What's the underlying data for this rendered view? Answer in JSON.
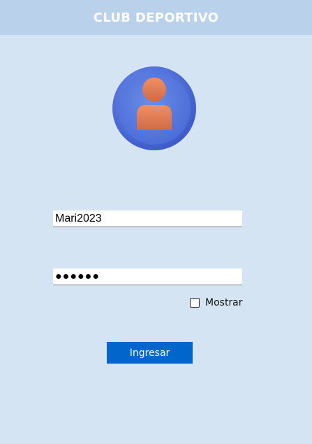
{
  "header": {
    "title": "CLUB DEPORTIVO"
  },
  "avatar": {
    "icon": "user-icon",
    "colors": {
      "circle": "#4f72d9",
      "figure": "#e07a52"
    }
  },
  "form": {
    "username_value": "Mari2023",
    "password_masked": "●●●●●●",
    "show_label": "Mostrar",
    "show_checked": false,
    "submit_label": "Ingresar"
  },
  "colors": {
    "background": "#d5e4f2",
    "header": "#b9d1ea",
    "button": "#0066cc"
  }
}
